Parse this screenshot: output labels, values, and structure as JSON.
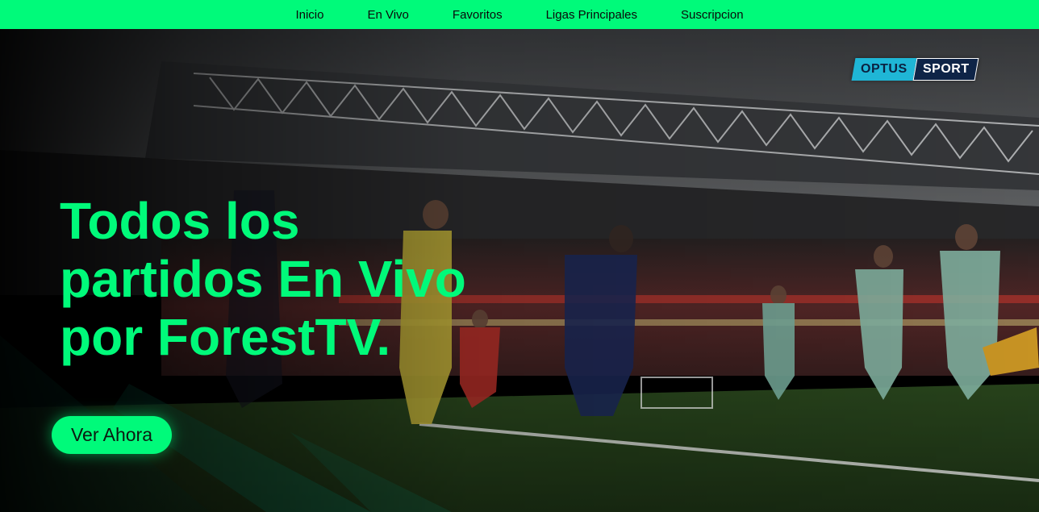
{
  "nav": {
    "items": [
      {
        "label": "Inicio"
      },
      {
        "label": "En Vivo"
      },
      {
        "label": "Favoritos"
      },
      {
        "label": "Ligas Principales"
      },
      {
        "label": "Suscripcion"
      }
    ]
  },
  "hero": {
    "title_lines": [
      "Todos los",
      "partidos En Vivo",
      "por ForestTV."
    ],
    "cta_label": "Ver Ahora",
    "badge": {
      "left": "OPTUS",
      "right": "SPORT"
    },
    "background_image": "stadium-match-photo"
  },
  "colors": {
    "accent": "#00fa7a",
    "badge_left": "#1fb6d6",
    "badge_right": "#0e2447"
  }
}
